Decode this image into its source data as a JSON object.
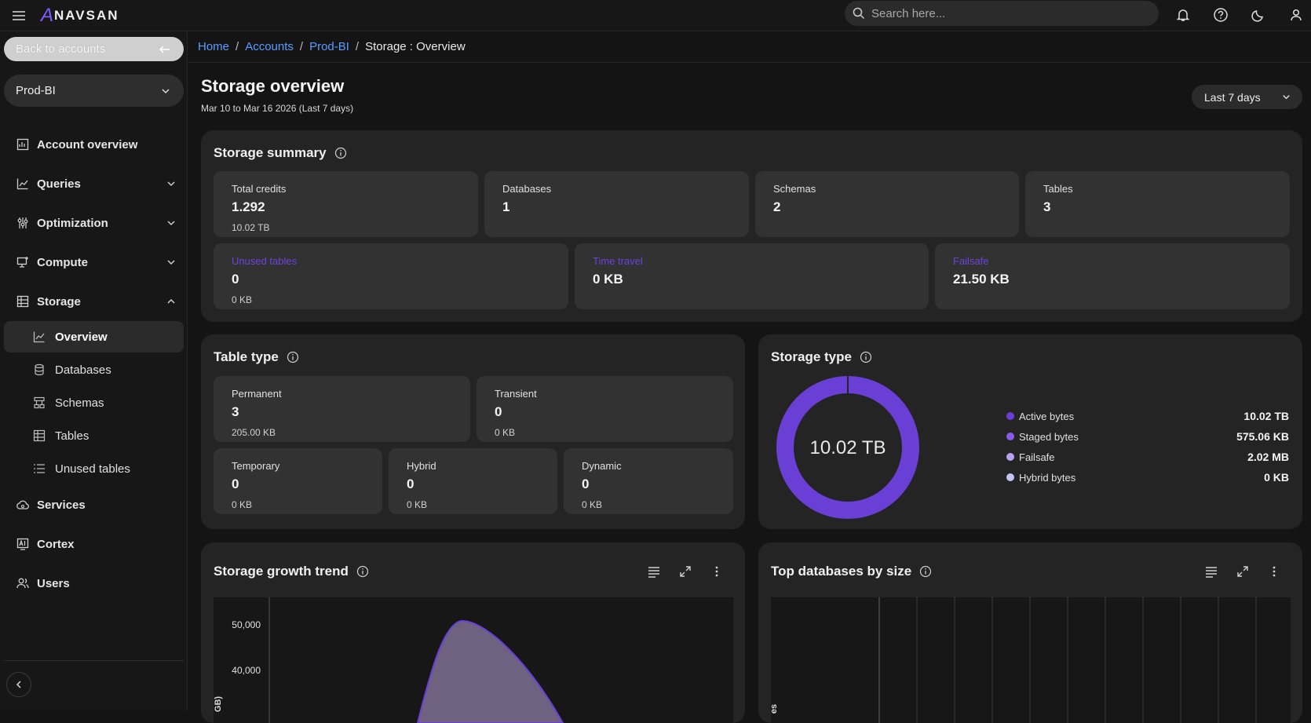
{
  "topbar": {
    "logo_text": "NAVSAN",
    "logo_mark": "A",
    "search_placeholder": "Search here..."
  },
  "sidebar": {
    "back_label": "Back to accounts",
    "account_selected": "Prod-BI",
    "nav": [
      {
        "label": "Account overview"
      },
      {
        "label": "Queries"
      },
      {
        "label": "Optimization"
      },
      {
        "label": "Compute"
      },
      {
        "label": "Storage"
      },
      {
        "label": "Services"
      },
      {
        "label": "Cortex"
      },
      {
        "label": "Users"
      }
    ],
    "storage_sub": [
      {
        "label": "Overview"
      },
      {
        "label": "Databases"
      },
      {
        "label": "Schemas"
      },
      {
        "label": "Tables"
      },
      {
        "label": "Unused tables"
      }
    ]
  },
  "breadcrumb": {
    "home": "Home",
    "accounts": "Accounts",
    "account": "Prod-BI",
    "current": "Storage : Overview"
  },
  "header": {
    "title": "Storage overview",
    "subtitle": "Mar 10 to Mar 16 2026 (Last 7 days)",
    "range_label": "Last 7 days"
  },
  "summary": {
    "title": "Storage summary",
    "total_credits": {
      "label": "Total credits",
      "value": "1.292",
      "sub": "10.02 TB"
    },
    "databases": {
      "label": "Databases",
      "value": "1"
    },
    "schemas": {
      "label": "Schemas",
      "value": "2"
    },
    "tables": {
      "label": "Tables",
      "value": "3"
    },
    "unused_tables": {
      "label": "Unused tables",
      "value": "0",
      "sub": "0 KB"
    },
    "time_travel": {
      "label": "Time travel",
      "value": "0 KB"
    },
    "failsafe": {
      "label": "Failsafe",
      "value": "21.50 KB"
    }
  },
  "table_type": {
    "title": "Table type",
    "permanent": {
      "label": "Permanent",
      "value": "3",
      "sub": "205.00 KB"
    },
    "transient": {
      "label": "Transient",
      "value": "0",
      "sub": "0 KB"
    },
    "temporary": {
      "label": "Temporary",
      "value": "0",
      "sub": "0 KB"
    },
    "hybrid": {
      "label": "Hybrid",
      "value": "0",
      "sub": "0 KB"
    },
    "dynamic": {
      "label": "Dynamic",
      "value": "0",
      "sub": "0 KB"
    }
  },
  "storage_type": {
    "title": "Storage type",
    "center_label": "10.02 TB",
    "legend": [
      {
        "label": "Active bytes",
        "value": "10.02 TB",
        "color": "#6a3fd6"
      },
      {
        "label": "Staged bytes",
        "value": "575.06 KB",
        "color": "#8a5ce6"
      },
      {
        "label": "Failsafe",
        "value": "2.02 MB",
        "color": "#b9a3f0"
      },
      {
        "label": "Hybrid bytes",
        "value": "0 KB",
        "color": "#c7c3f5"
      }
    ]
  },
  "growth": {
    "title": "Storage growth trend",
    "yticks": [
      "50,000",
      "40,000"
    ],
    "ylabel_fragment": "GB)"
  },
  "top_dbs": {
    "title": "Top databases by size",
    "ylabel_fragment": "es"
  },
  "colors": {
    "accent": "#6a3fd6",
    "link": "#5b9cff"
  }
}
